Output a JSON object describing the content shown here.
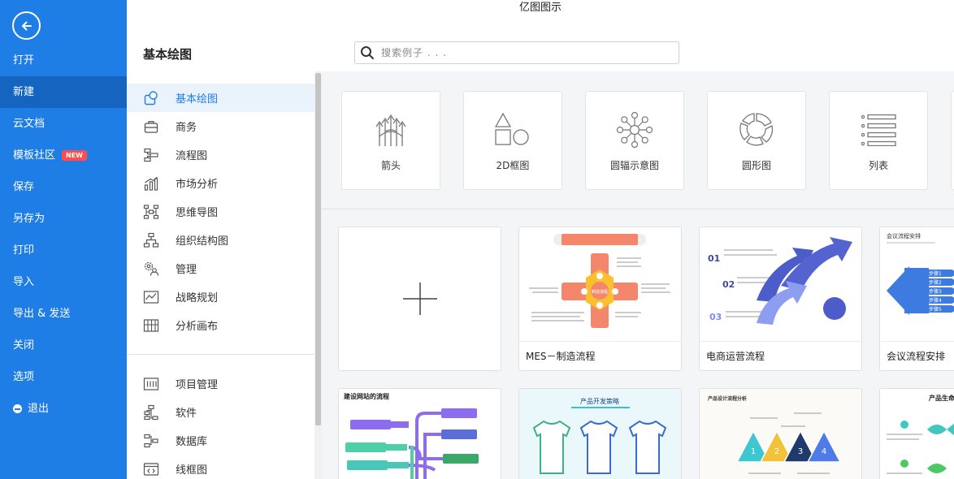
{
  "window": {
    "title": "亿图图示"
  },
  "left_menu": {
    "items": [
      {
        "label": "打开",
        "active": false
      },
      {
        "label": "新建",
        "active": true
      },
      {
        "label": "云文档",
        "active": false
      },
      {
        "label": "模板社区",
        "active": false,
        "badge": "NEW"
      },
      {
        "label": "保存",
        "active": false
      },
      {
        "label": "另存为",
        "active": false
      },
      {
        "label": "打印",
        "active": false
      },
      {
        "label": "导入",
        "active": false
      },
      {
        "label": "导出 & 发送",
        "active": false
      },
      {
        "label": "关闭",
        "active": false
      },
      {
        "label": "选项",
        "active": false
      },
      {
        "label": "退出",
        "active": false
      }
    ]
  },
  "header": {
    "title": "基本绘图",
    "search_placeholder": "搜索例子 . . ."
  },
  "categories": {
    "group1": [
      {
        "label": "基本绘图",
        "icon": "basic-drawing-icon",
        "active": true
      },
      {
        "label": "商务",
        "icon": "briefcase-icon"
      },
      {
        "label": "流程图",
        "icon": "flowchart-icon"
      },
      {
        "label": "市场分析",
        "icon": "bar-chart-icon"
      },
      {
        "label": "思维导图",
        "icon": "mindmap-icon"
      },
      {
        "label": "组织结构图",
        "icon": "org-chart-icon"
      },
      {
        "label": "管理",
        "icon": "management-icon"
      },
      {
        "label": "战略规划",
        "icon": "strategy-icon"
      },
      {
        "label": "分析画布",
        "icon": "canvas-icon"
      }
    ],
    "group2": [
      {
        "label": "项目管理",
        "icon": "project-icon"
      },
      {
        "label": "软件",
        "icon": "software-icon"
      },
      {
        "label": "数据库",
        "icon": "database-icon"
      },
      {
        "label": "线框图",
        "icon": "wireframe-icon"
      }
    ]
  },
  "diagram_types": [
    {
      "label": "箭头",
      "icon": "arrows-icon"
    },
    {
      "label": "2D框图",
      "icon": "shapes-2d-icon"
    },
    {
      "label": "圆辐示意图",
      "icon": "radial-icon"
    },
    {
      "label": "圆形图",
      "icon": "circular-icon"
    },
    {
      "label": "列表",
      "icon": "list-icon"
    }
  ],
  "templates": {
    "row1": [
      {
        "label": "",
        "kind": "blank"
      },
      {
        "label": "MES－制造流程",
        "kind": "mes"
      },
      {
        "label": "电商运营流程",
        "kind": "ecommerce"
      },
      {
        "label": "会议流程安排",
        "kind": "meeting"
      }
    ],
    "row2": [
      {
        "label": "",
        "kind": "website",
        "thumb_title": "建设网站的流程"
      },
      {
        "label": "",
        "kind": "product",
        "thumb_title": "产品开发策略"
      },
      {
        "label": "",
        "kind": "design",
        "thumb_title": "产品设计流程分析"
      },
      {
        "label": "",
        "kind": "lifecycle",
        "thumb_title": "产品生命"
      }
    ]
  },
  "thumb_text": {
    "meeting_title": "会议流程安排",
    "meeting_steps": [
      "步骤1",
      "步骤2",
      "步骤3",
      "步骤4",
      "步骤5"
    ],
    "ecommerce_nums": [
      "01",
      "02",
      "03"
    ],
    "mes_center": "制造流程",
    "design_nums": [
      "1",
      "2",
      "3",
      "4"
    ]
  },
  "colors": {
    "primary": "#1e7ee6",
    "primary_dark": "#1565c0",
    "badge": "#ff4d4f",
    "active_bg": "#eaf3fc"
  }
}
